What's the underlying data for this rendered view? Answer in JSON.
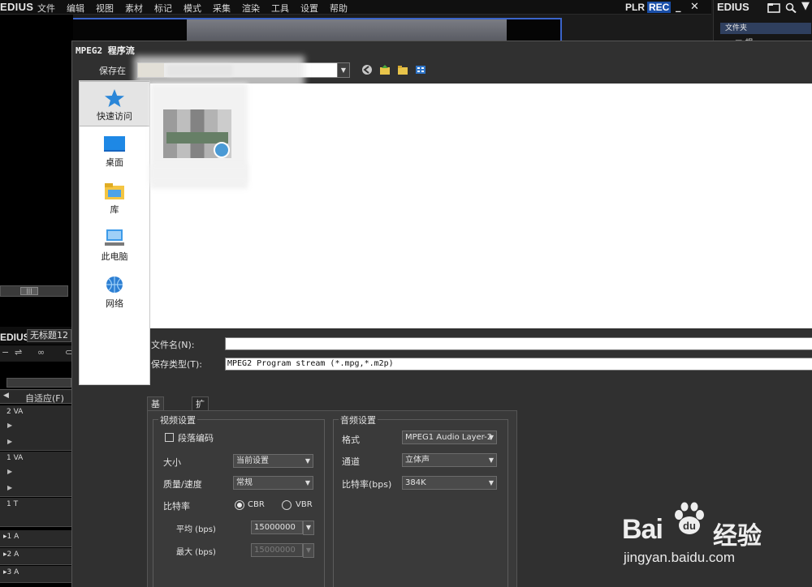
{
  "menubar": {
    "brand": "EDIUS",
    "items": [
      "文件",
      "编辑",
      "视图",
      "素材",
      "标记",
      "模式",
      "采集",
      "渲染",
      "工具",
      "设置",
      "帮助"
    ],
    "plr": "PLR",
    "rec": "REC",
    "minimize": "_",
    "close": "✕"
  },
  "bin_panel": {
    "brand": "EDIUS",
    "folder_header": "文件夹",
    "root_node": "根"
  },
  "timeline": {
    "brand": "EDIUS",
    "sequence_title": "无标题12",
    "fit_label": "自适应(F)",
    "tracks": [
      "2 VA",
      "1 VA",
      "1 T",
      "1 A",
      "2 A",
      "3 A"
    ]
  },
  "dialog": {
    "title": "MPEG2 程序流",
    "save_in_label": "保存在",
    "places": [
      {
        "label": "快速访问",
        "icon": "star-icon"
      },
      {
        "label": "桌面",
        "icon": "desktop-icon"
      },
      {
        "label": "库",
        "icon": "library-folder-icon"
      },
      {
        "label": "此电脑",
        "icon": "computer-icon"
      },
      {
        "label": "网络",
        "icon": "network-icon"
      }
    ],
    "filename_label": "文件名(N):",
    "filename_value": "",
    "savetype_label": "保存类型(T):",
    "savetype_value": "MPEG2 Program stream (*.mpg,*.m2p)",
    "tabs": [
      "基本设置",
      "扩展设置"
    ],
    "video": {
      "group_title": "视频设置",
      "segment_encoding": "段落编码",
      "size_label": "大小",
      "size_value": "当前设置",
      "quality_label": "质量/速度",
      "quality_value": "常规",
      "bitrate_label": "比特率",
      "cbr": "CBR",
      "vbr": "VBR",
      "avg_label": "平均 (bps)",
      "avg_value": "15000000",
      "max_label": "最大 (bps)",
      "max_value": "15000000"
    },
    "audio": {
      "group_title": "音频设置",
      "format_label": "格式",
      "format_value": "MPEG1 Audio Layer-2",
      "channel_label": "通道",
      "channel_value": "立体声",
      "bitrate_label": "比特率(bps)",
      "bitrate_value": "384K"
    }
  },
  "watermark": {
    "brand_latin": "Bai",
    "brand_du": "du",
    "brand_cn": "经验",
    "url": "jingyan.baidu.com"
  }
}
